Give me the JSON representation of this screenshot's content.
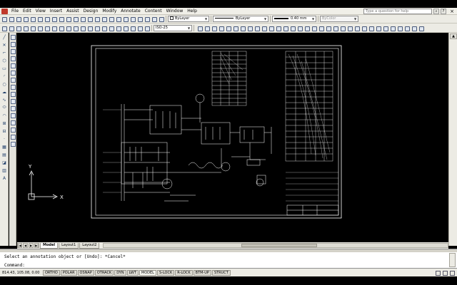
{
  "menu": {
    "items": [
      "File",
      "Edit",
      "View",
      "Insert",
      "Assist",
      "Design",
      "Modify",
      "Annotate",
      "Content",
      "Window",
      "Help"
    ],
    "search_placeholder": "Type a question for help"
  },
  "toolbar1": {
    "layer_combo": "ByLayer",
    "linetype_combo": "ByLayer",
    "lineweight_combo": "0.40 mm",
    "plotstyle_combo": "ByColor"
  },
  "toolbar2": {
    "dimstyle_combo": "ISO-25"
  },
  "tabs": [
    {
      "label": "Model",
      "active": true
    },
    {
      "label": "Layout1",
      "active": false
    },
    {
      "label": "Layout2",
      "active": false
    }
  ],
  "ucs": {
    "x_label": "X",
    "y_label": "Y"
  },
  "command": {
    "history": "Select an annotation object or [Undo]: *Cancel*",
    "prompt": "Command:"
  },
  "status": {
    "coordinates": "814.43, 105.08, 0.00",
    "toggles": [
      {
        "label": "ORTHO",
        "on": false
      },
      {
        "label": "POLAR",
        "on": false
      },
      {
        "label": "OSNAP",
        "on": false
      },
      {
        "label": "OTRACK",
        "on": false
      },
      {
        "label": "DYN",
        "on": false
      },
      {
        "label": "LWT",
        "on": false
      },
      {
        "label": "MODEL",
        "on": true
      },
      {
        "label": "S-LOCK",
        "on": false
      },
      {
        "label": "R-LOCK",
        "on": false
      },
      {
        "label": "BTM-UP",
        "on": false
      },
      {
        "label": "STRUCT",
        "on": false
      }
    ]
  },
  "colors": {
    "canvas": "#000000",
    "drawing_lines": "#ffffff",
    "ui_panel": "#ecebe4"
  }
}
